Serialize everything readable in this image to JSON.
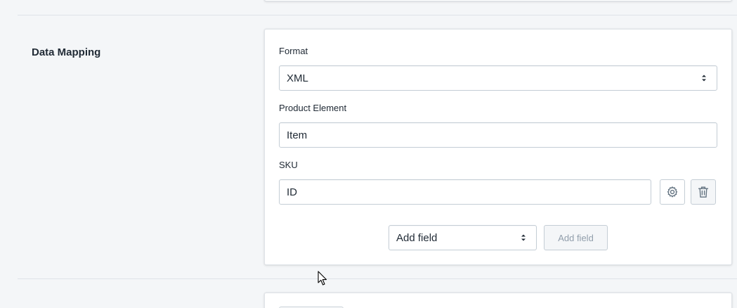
{
  "section": {
    "title": "Data Mapping"
  },
  "format": {
    "label": "Format",
    "selected": "XML"
  },
  "product_element": {
    "label": "Product Element",
    "value": "Item"
  },
  "sku": {
    "label": "SKU",
    "value": "ID"
  },
  "add_field": {
    "select_value": "Add field",
    "button_label": "Add field"
  },
  "icons": {
    "settings": "gear-icon",
    "delete": "trash-icon",
    "cursor": "mouse-pointer-icon"
  },
  "colors": {
    "page_bg": "#f4f6f8",
    "card_bg": "#ffffff",
    "border": "#c4cdd5",
    "icon": "#637381",
    "disabled_text": "#919eab"
  }
}
